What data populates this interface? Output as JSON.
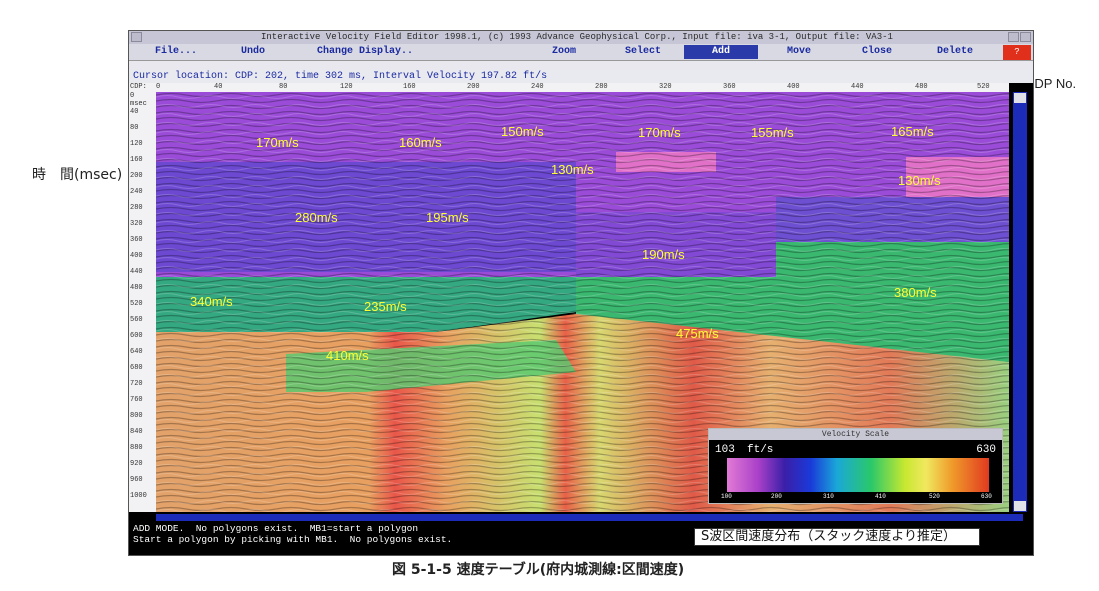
{
  "side_label": "時　間(msec)",
  "cdp_note": "←CDP  No.",
  "caption": "図 5-1-5  速度テーブル(府内城測線:区間速度)",
  "window": {
    "title": "Interactive Velocity Field Editor 1998.1,  (c) 1993 Advance Geophysical Corp.,   Input file: iva 3-1,   Output file: VA3-1",
    "menu": [
      "File...",
      "Undo",
      "Change Display..",
      "Zoom",
      "Select",
      "Add",
      "Move",
      "Close",
      "Delete"
    ],
    "active_menu": "Add",
    "help_label": "?",
    "cursor_line": "Cursor location:  CDP:   202, time    302  ms, Interval Velocity   197.82 ft/s",
    "x_ruler_label": "CDP:",
    "x_ticks": [
      "0",
      "40",
      "80",
      "120",
      "160",
      "200",
      "240",
      "280",
      "320",
      "360",
      "400",
      "440",
      "480",
      "520"
    ],
    "y_ruler_label": "msec",
    "y_ticks": [
      "0",
      "40",
      "80",
      "120",
      "160",
      "200",
      "240",
      "280",
      "320",
      "360",
      "400",
      "440",
      "480",
      "520",
      "560",
      "600",
      "640",
      "680",
      "720",
      "760",
      "800",
      "840",
      "880",
      "920",
      "960",
      "1000"
    ],
    "messages": "ADD MODE.  No polygons exist.  MB1=start a polygon\nStart a polygon by picking with MB1.  No polygons exist."
  },
  "velocity_labels": [
    "170m/s",
    "160m/s",
    "150m/s",
    "170m/s",
    "155m/s",
    "165m/s",
    "130m/s",
    "130m/s",
    "280m/s",
    "195m/s",
    "190m/s",
    "340m/s",
    "235m/s",
    "380m/s",
    "475m/s",
    "410m/s"
  ],
  "velocity_scale": {
    "title": "Velocity Scale",
    "min": "103",
    "unit": "ft/s",
    "max": "630",
    "ticks": [
      "100",
      "200",
      "310",
      "410",
      "520",
      "630"
    ]
  },
  "note_box": "S波区間速度分布（スタック速度より推定）"
}
